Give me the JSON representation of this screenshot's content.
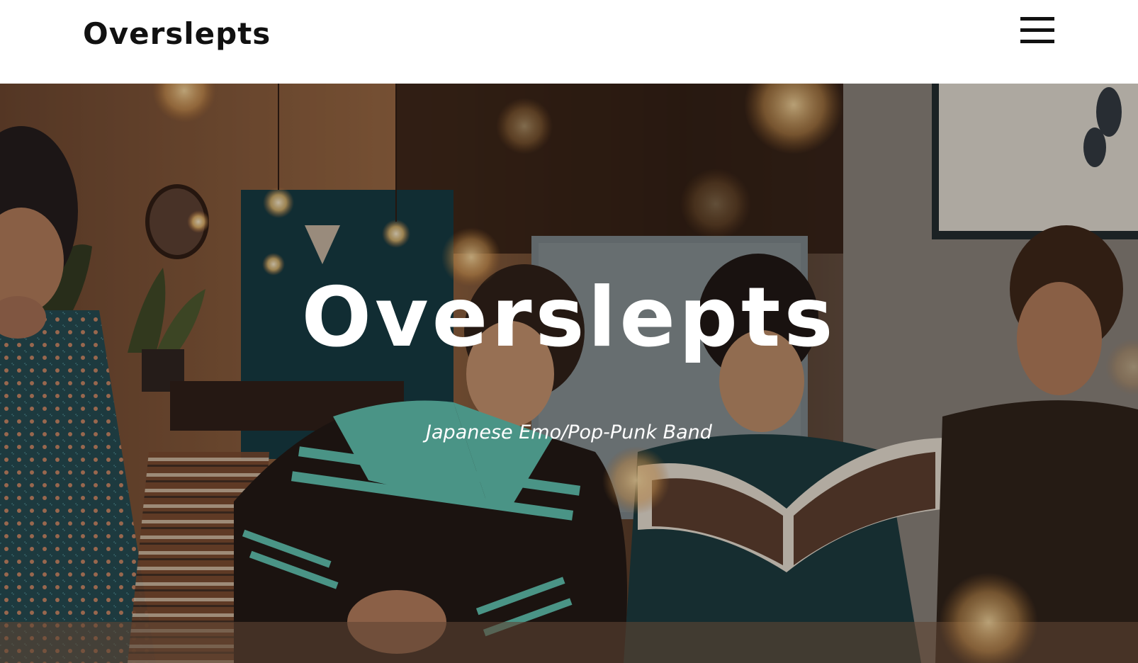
{
  "header": {
    "site_title": "Overslepts",
    "menu_icon": "hamburger-menu-icon"
  },
  "hero": {
    "title": "Overslepts",
    "tagline": "Japanese Emo/Pop-Punk Band",
    "image_description_icon": "band-photo"
  },
  "colors": {
    "header_bg": "#ffffff",
    "header_text": "#111111",
    "hero_text": "#ffffff",
    "jacket_teal": "#5ec8b8",
    "warm_light": "#f5c27a"
  }
}
